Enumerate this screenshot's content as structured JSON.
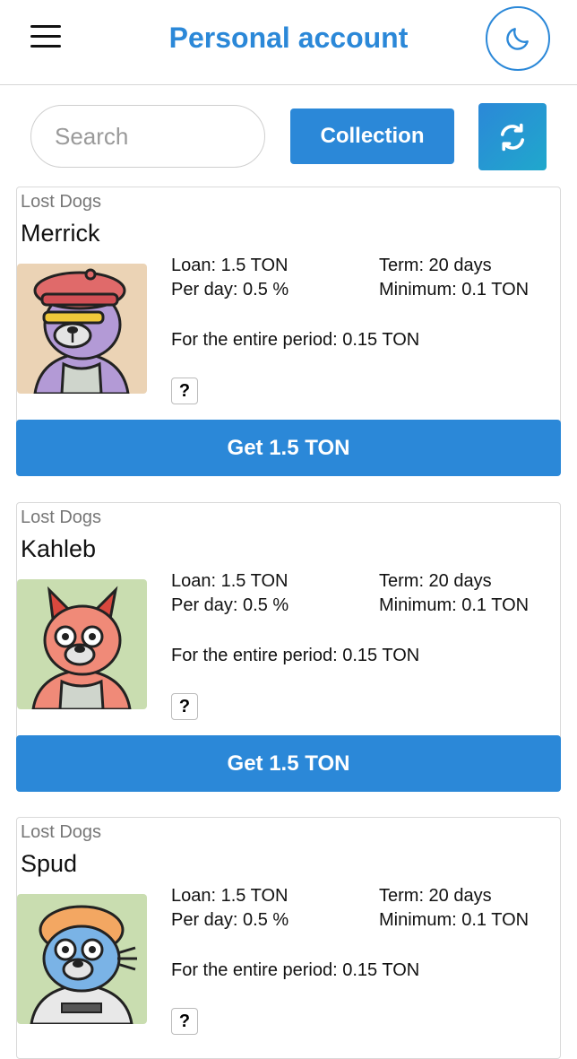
{
  "header": {
    "title": "Personal account",
    "menu_icon": "hamburger-menu-icon",
    "theme_icon": "moon-icon"
  },
  "toolbar": {
    "search_placeholder": "Search",
    "collection_label": "Collection",
    "refresh_icon": "refresh-icon"
  },
  "colors": {
    "accent": "#2b88d8",
    "text": "#111111",
    "muted": "#777777"
  },
  "cards": [
    {
      "collection": "Lost Dogs",
      "name": "Merrick",
      "loan": "Loan: 1.5 TON",
      "term": "Term: 20 days",
      "per_day": "Per day: 0.5 %",
      "minimum": "Minimum: 0.1 TON",
      "period": "For the entire period: 0.15 TON",
      "help": "?",
      "action": "Get 1.5 TON"
    },
    {
      "collection": "Lost Dogs",
      "name": "Kahleb",
      "loan": "Loan: 1.5 TON",
      "term": "Term: 20 days",
      "per_day": "Per day: 0.5 %",
      "minimum": "Minimum: 0.1 TON",
      "period": "For the entire period: 0.15 TON",
      "help": "?",
      "action": "Get 1.5 TON"
    },
    {
      "collection": "Lost Dogs",
      "name": "Spud",
      "loan": "Loan: 1.5 TON",
      "term": "Term: 20 days",
      "per_day": "Per day: 0.5 %",
      "minimum": "Minimum: 0.1 TON",
      "period": "For the entire period: 0.15 TON",
      "help": "?"
    }
  ]
}
